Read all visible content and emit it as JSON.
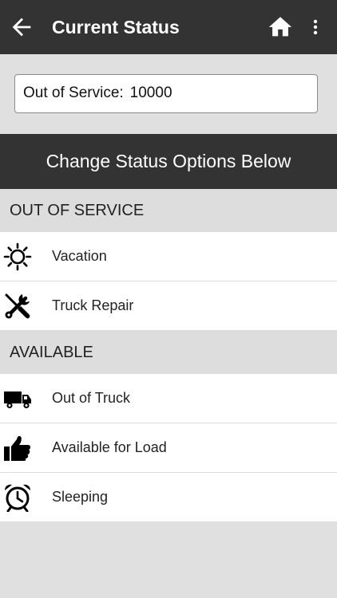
{
  "app_bar": {
    "title": "Current Status",
    "icons": [
      "back-arrow-icon",
      "home-icon",
      "more-vert-icon"
    ]
  },
  "current_status": {
    "label": "Out of Service:",
    "value": "10000"
  },
  "banner": {
    "text": "Change Status Options Below"
  },
  "sections": [
    {
      "header": "OUT OF SERVICE",
      "items": [
        {
          "label": "Vacation",
          "icon": "sun-icon"
        },
        {
          "label": "Truck Repair",
          "icon": "wrench-screwdriver-icon"
        }
      ]
    },
    {
      "header": "AVAILABLE",
      "items": [
        {
          "label": "Out of Truck",
          "icon": "truck-icon"
        },
        {
          "label": "Available for Load",
          "icon": "thumbs-up-icon"
        },
        {
          "label": "Sleeping",
          "icon": "alarm-clock-icon"
        }
      ]
    }
  ],
  "colors": {
    "app_bar_bg": "#333333",
    "banner_bg": "#333333",
    "page_bg": "#e0e0e0",
    "row_bg": "#ffffff",
    "text": "#222222"
  }
}
